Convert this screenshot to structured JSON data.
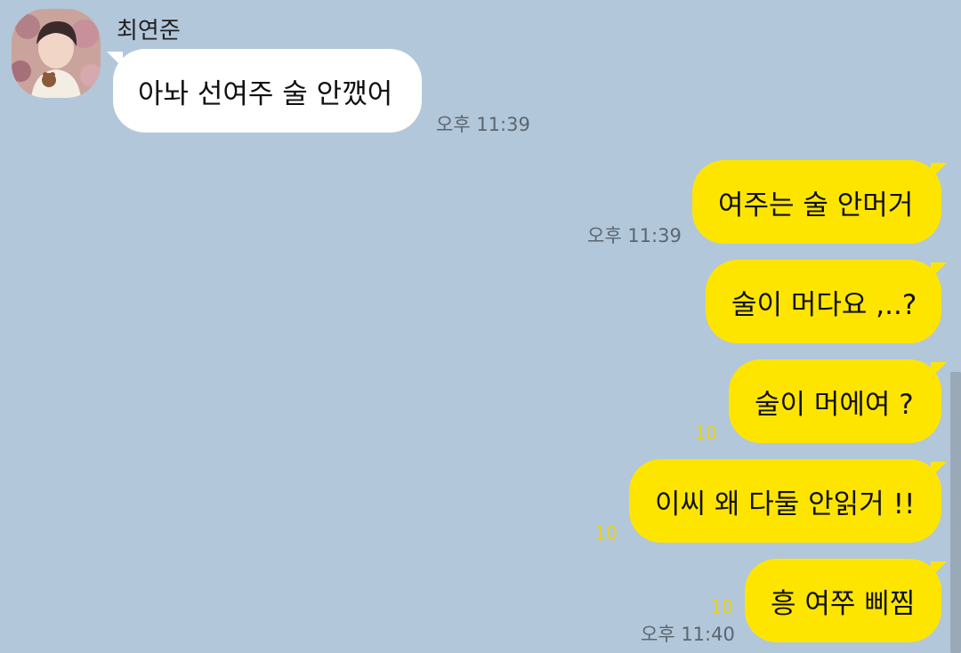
{
  "contact": {
    "name": "최연준",
    "avatar_icon": "profile-photo"
  },
  "messages": [
    {
      "sender": "contact",
      "text": "아놔 선여주 술 안깼어",
      "time": "오후 11:39",
      "unread": ""
    },
    {
      "sender": "me",
      "text": "여주는 술 안머거",
      "time": "오후 11:39",
      "unread": ""
    },
    {
      "sender": "me",
      "text": "술이 머다요 ,..?",
      "time": "",
      "unread": ""
    },
    {
      "sender": "me",
      "text": "술이 머에여 ?",
      "time": "",
      "unread": "10"
    },
    {
      "sender": "me",
      "text": "이씨 왜 다둘 안읽거 !!",
      "time": "",
      "unread": "10"
    },
    {
      "sender": "me",
      "text": "흥 여쭈 삐찜",
      "time": "오후 11:40",
      "unread": "10"
    }
  ],
  "colors": {
    "background": "#b2c7da",
    "my_bubble": "#fee500",
    "their_bubble": "#ffffff",
    "unread_count": "#e8d21f"
  }
}
